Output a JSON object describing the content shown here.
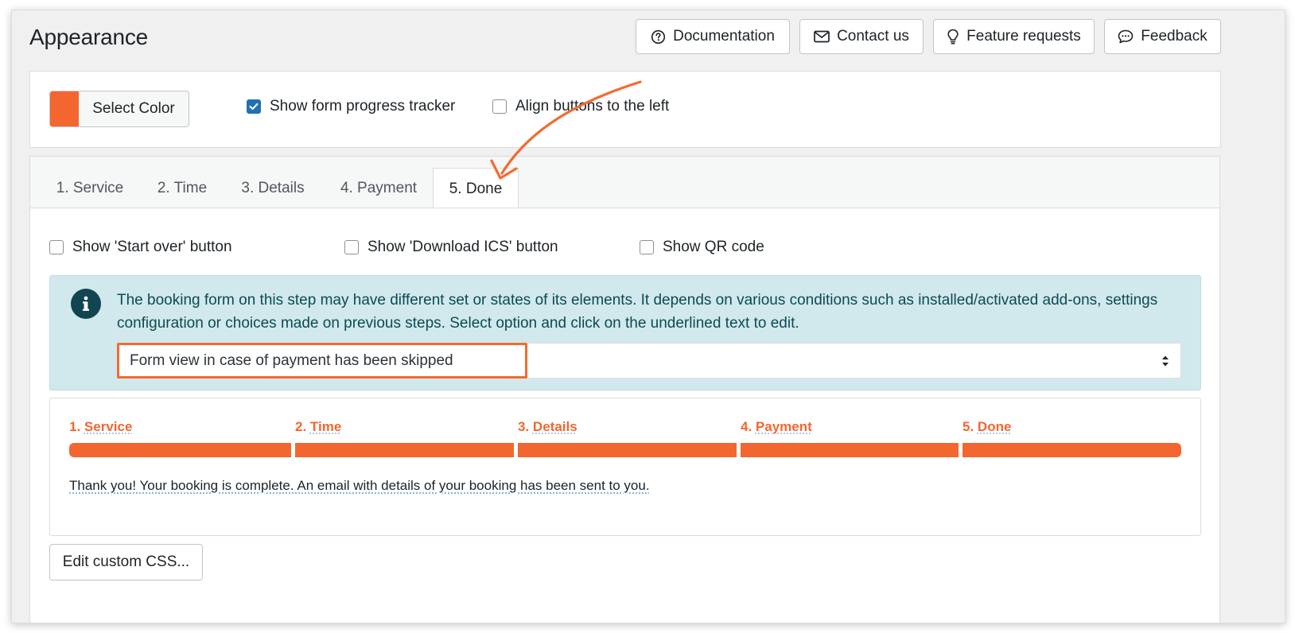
{
  "header": {
    "title": "Appearance",
    "buttons": {
      "documentation": "Documentation",
      "contact": "Contact us",
      "feature": "Feature requests",
      "feedback": "Feedback"
    }
  },
  "settings": {
    "color_button": "Select Color",
    "color_value": "#f4662f",
    "show_progress": {
      "label": "Show form progress tracker",
      "checked": true
    },
    "align_left": {
      "label": "Align buttons to the left",
      "checked": false
    }
  },
  "tabs": [
    {
      "label": "1. Service",
      "active": false
    },
    {
      "label": "2. Time",
      "active": false
    },
    {
      "label": "3. Details",
      "active": false
    },
    {
      "label": "4. Payment",
      "active": false
    },
    {
      "label": "5. Done",
      "active": true
    }
  ],
  "done_options": {
    "start_over": "Show 'Start over' button",
    "download_ics": "Show 'Download ICS' button",
    "qr_code": "Show QR code"
  },
  "info": {
    "text": "The booking form on this step may have different set or states of its elements. It depends on various conditions such as installed/activated add-ons, settings configuration or choices made on previous steps. Select option and click on the underlined text to edit.",
    "select_value": "Form view in case of payment has been skipped"
  },
  "preview": {
    "steps": [
      {
        "num": "1.",
        "name": "Service"
      },
      {
        "num": "2.",
        "name": "Time"
      },
      {
        "num": "3.",
        "name": "Details"
      },
      {
        "num": "4.",
        "name": "Payment"
      },
      {
        "num": "5.",
        "name": "Done"
      }
    ],
    "message": "Thank you! Your booking is complete. An email with details of your booking has been sent to you."
  },
  "footer": {
    "css_button": "Edit custom CSS..."
  },
  "colors": {
    "accent": "#f4662f",
    "checkbox_checked": "#2271b1",
    "info_bg": "#d1e9ec",
    "info_text": "#0c4a55"
  }
}
